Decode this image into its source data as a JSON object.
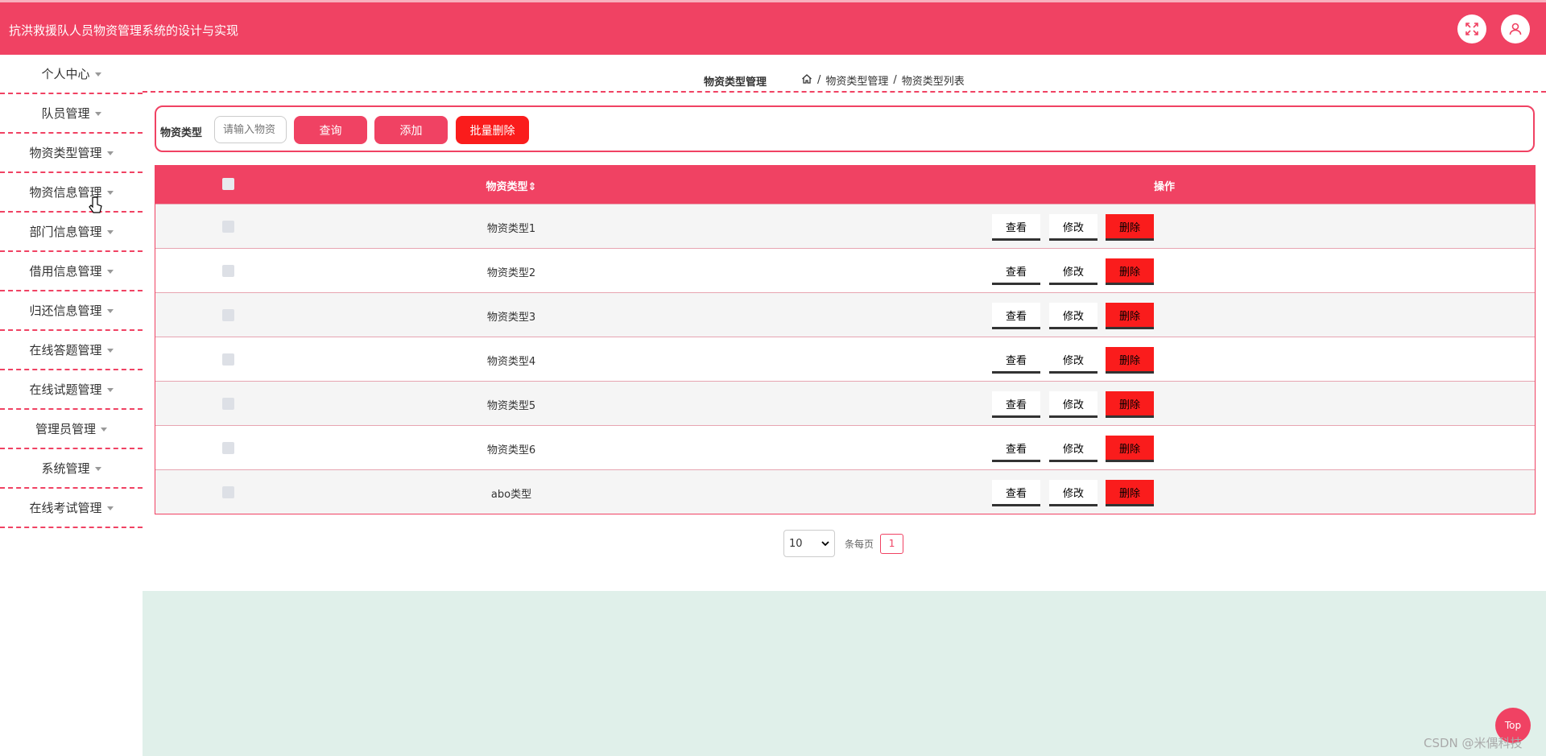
{
  "header": {
    "title": "抗洪救援队人员物资管理系统的设计与实现",
    "icons": [
      "fullscreen-icon",
      "user-icon"
    ]
  },
  "sidebar": {
    "items": [
      {
        "label": "个人中心"
      },
      {
        "label": "队员管理"
      },
      {
        "label": "物资类型管理"
      },
      {
        "label": "物资信息管理"
      },
      {
        "label": "部门信息管理"
      },
      {
        "label": "借用信息管理"
      },
      {
        "label": "归还信息管理"
      },
      {
        "label": "在线答题管理"
      },
      {
        "label": "在线试题管理"
      },
      {
        "label": "管理员管理"
      },
      {
        "label": "系统管理"
      },
      {
        "label": "在线考试管理"
      }
    ]
  },
  "breadcrumb": {
    "title": "物资类型管理",
    "level1": "物资类型管理",
    "level2": "物资类型列表",
    "separator": "/"
  },
  "search": {
    "label": "物资类型",
    "placeholder": "请输入物资",
    "query_label": "查询",
    "add_label": "添加",
    "batch_delete_label": "批量删除"
  },
  "table": {
    "headers": {
      "name": "物资类型",
      "sort_glyph": "⇕",
      "actions": "操作"
    },
    "rows": [
      {
        "name": "物资类型1"
      },
      {
        "name": "物资类型2"
      },
      {
        "name": "物资类型3"
      },
      {
        "name": "物资类型4"
      },
      {
        "name": "物资类型5"
      },
      {
        "name": "物资类型6"
      },
      {
        "name": "abo类型"
      }
    ],
    "actions": {
      "view": "查看",
      "edit": "修改",
      "delete": "删除"
    }
  },
  "pagination": {
    "page_size": "10",
    "per_page_text": "条每页",
    "current_page": "1"
  },
  "floating": {
    "top_label": "Top"
  },
  "watermark": "CSDN @米偶科技",
  "colors": {
    "accent": "#f04263",
    "danger": "#fa1c1c",
    "bottom_bg": "#e0f0ea"
  }
}
